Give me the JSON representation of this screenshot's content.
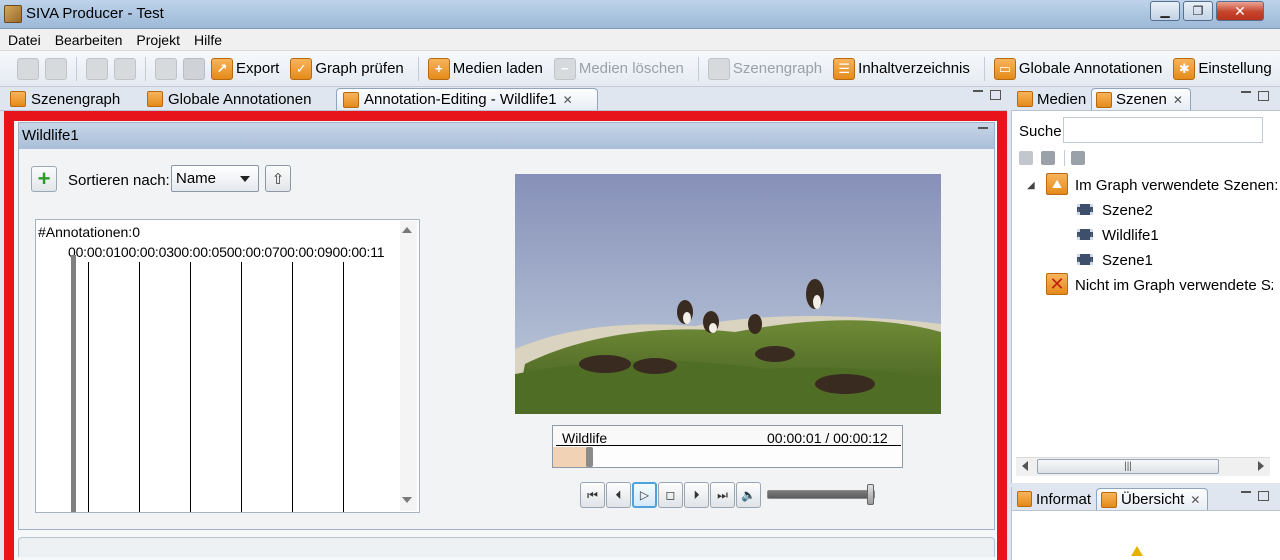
{
  "window": {
    "title": "SIVA Producer - Test",
    "minimize": "▁",
    "maximize": "❐",
    "close": "✕"
  },
  "menu": [
    "Datei",
    "Bearbeiten",
    "Projekt",
    "Hilfe"
  ],
  "toolbar": {
    "export": "Export",
    "graph_check": "Graph prüfen",
    "media_load": "Medien laden",
    "media_delete": "Medien löschen",
    "scenegraph": "Szenengraph",
    "contents": "Inhaltverzeichnis",
    "global_annotations": "Globale Annotationen",
    "settings": "Einstellung"
  },
  "editor_tabs": [
    "Szenengraph",
    "Globale Annotationen",
    "Annotation-Editing - Wildlife1"
  ],
  "panel": {
    "title": "Wildlife1",
    "sort_label": "Sortieren nach:",
    "sort_value": "Name",
    "annotation_count": "#Annotationen:0",
    "timeline_labels": "00:00:0100:00:0300:00:0500:00:0700:00:0900:00:11"
  },
  "player": {
    "media_name": "Wildlife",
    "time": "00:00:01 / 00:00:12",
    "progress_fraction": 0.08,
    "volume_fraction": 1.0
  },
  "right_tabs": [
    "Medien",
    "Szenen"
  ],
  "scenes": {
    "search_label": "Suche",
    "search_value": "",
    "used_group": "Im Graph verwendete Szenen:",
    "used_items": [
      "Szene2",
      "Wildlife1",
      "Szene1"
    ],
    "unused_group": "Nicht im Graph verwendete Sz"
  },
  "bottom_right_tabs": [
    "Informat",
    "Übersicht"
  ],
  "colors": {
    "highlight": "#e8141b",
    "accent_orange": "#e48a1a",
    "header_blue": "#a9bed8"
  }
}
